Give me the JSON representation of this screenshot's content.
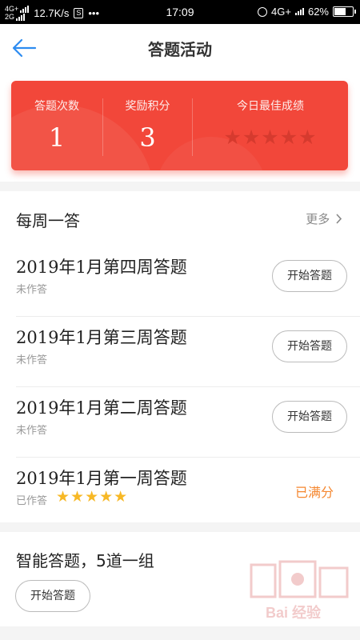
{
  "status_bar": {
    "network_top": "4G+",
    "network_bottom": "2G",
    "speed": "12.7K/s",
    "sim_label": "S",
    "more_dots": "•••",
    "time": "17:09",
    "network_right": "4G+",
    "battery_text": "62%",
    "battery_level": 0.62
  },
  "nav": {
    "back_icon": "back-arrow-icon",
    "title": "答题活动"
  },
  "summary": {
    "color": "#f2473a",
    "answer_count_label": "答题次数",
    "answer_count": "1",
    "points_label": "奖励积分",
    "points": "3",
    "best_label": "今日最佳成绩",
    "best_stars": "★★★★★",
    "best_stars_filled": 0,
    "best_stars_total": 5
  },
  "weekly": {
    "title": "每周一答",
    "more": "更多",
    "items": [
      {
        "title": "2019年1月第四周答题",
        "status": "未作答",
        "button": "开始答题"
      },
      {
        "title": "2019年1月第三周答题",
        "status": "未作答",
        "button": "开始答题"
      },
      {
        "title": "2019年1月第二周答题",
        "status": "未作答",
        "button": "开始答题"
      },
      {
        "title": "2019年1月第一周答题",
        "status": "已作答",
        "stars": "★★★★★",
        "stars_filled": 5,
        "result": "已满分"
      }
    ]
  },
  "smart": {
    "title": "智能答题，5道一组",
    "button": "开始答题"
  },
  "watermark": {
    "text": "Bai 经验"
  }
}
